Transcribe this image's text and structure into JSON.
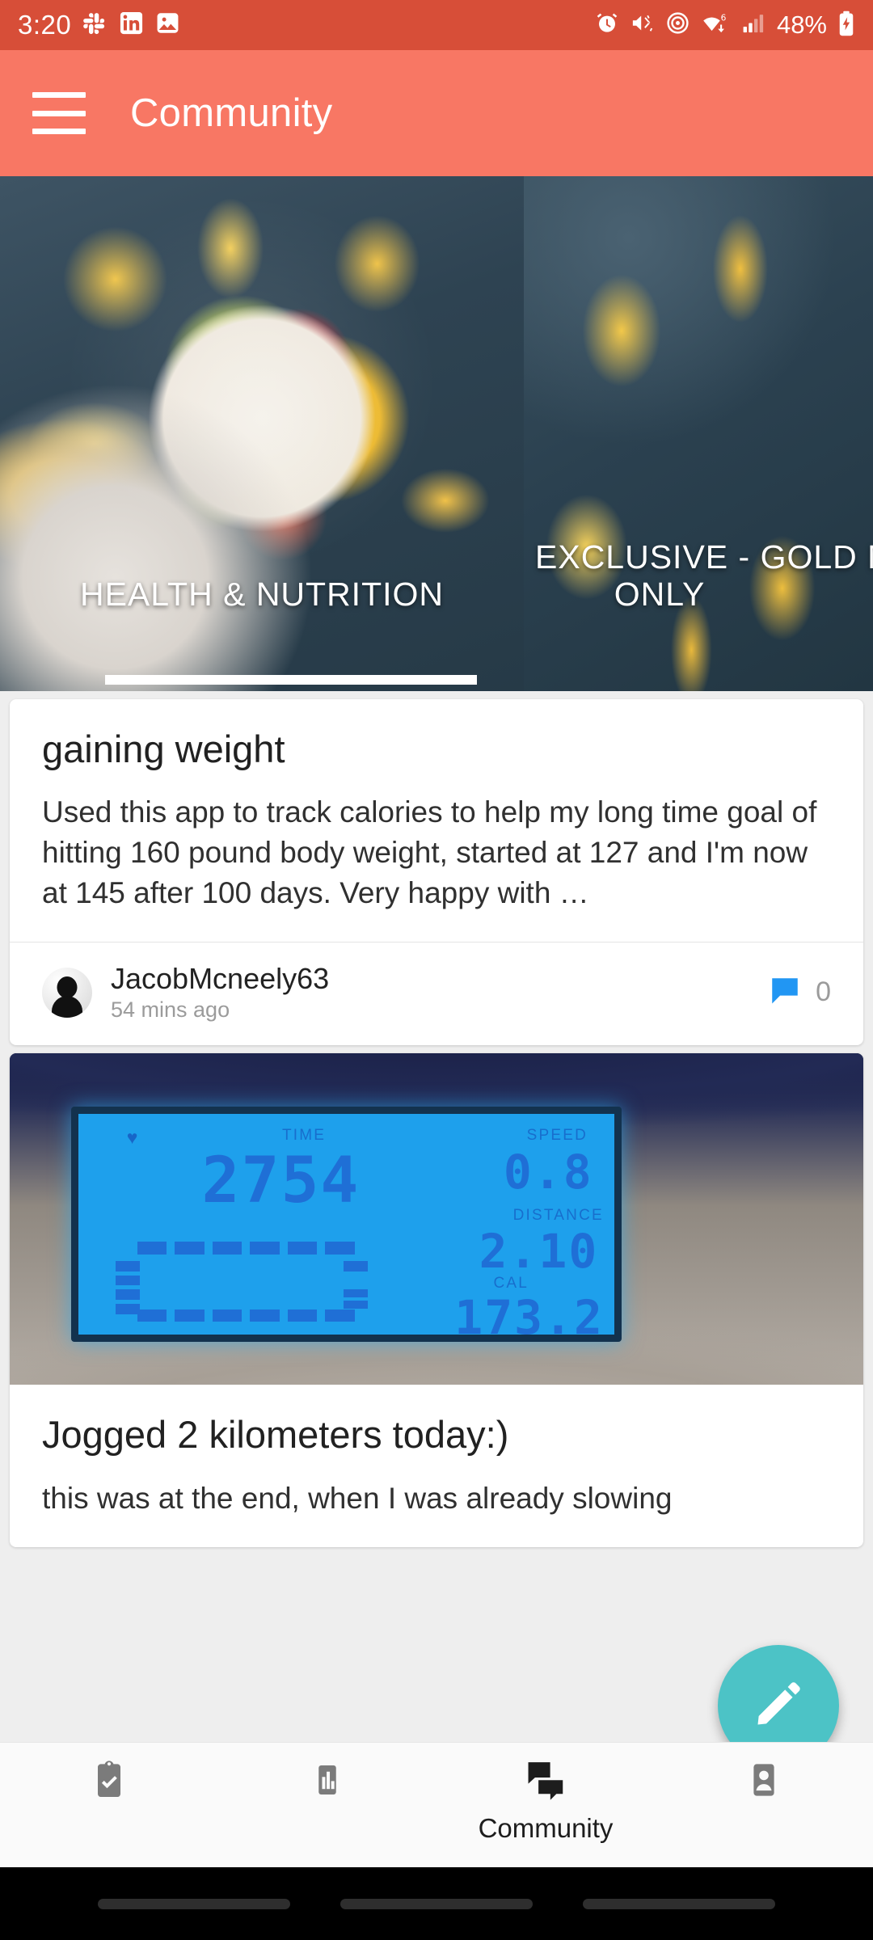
{
  "status_bar": {
    "time": "3:20",
    "battery": "48%",
    "left_icons": [
      "slack-icon",
      "linkedin-icon",
      "photos-icon"
    ],
    "right_icons": [
      "alarm-icon",
      "vibrate-icon",
      "hotspot-icon",
      "wifi-icon",
      "signal-icon",
      "battery-charging-icon"
    ],
    "wifi_generation": "6",
    "background_color": "#d74e38"
  },
  "app_bar": {
    "title": "Community",
    "menu_icon": "hamburger-menu-icon",
    "background_color": "#f87764"
  },
  "carousel": {
    "slides": [
      {
        "caption": "HEALTH & NUTRITION",
        "image": "fruit-platter-photo"
      },
      {
        "caption_line1": "EXCLUSIVE - GOLD ME",
        "caption_line2": "ONLY",
        "image": "gold-members-photo"
      }
    ],
    "indicator_color": "#ffffff"
  },
  "feed": {
    "posts": [
      {
        "title": "gaining weight",
        "text": "Used this app to track calories to help my long time goal of hitting 160 pound body weight, started at 127 and I'm now at 145 after 100 days. Very happy with …",
        "author": "JacobMcneely63",
        "time": "54 mins ago",
        "comment_count": "0",
        "comment_icon_color": "#2196f3",
        "avatar": "user-avatar"
      },
      {
        "title": "Jogged 2 kilometers today:)",
        "text": "this was at the end, when I was already slowing",
        "image": "treadmill-console-photo",
        "treadmill": {
          "heart_icon": "heart-icon",
          "time_label": "TIME",
          "time_value": "2754",
          "speed_label": "SPEED",
          "speed_value": "0.8",
          "distance_label": "DISTANCE",
          "distance_value": "2.10",
          "cal_label": "CAL",
          "cal_value": "173.2"
        }
      }
    ]
  },
  "fab": {
    "name": "compose-post-button",
    "icon": "pencil-icon",
    "color": "#4cc3c6"
  },
  "bottom_nav": {
    "items": [
      {
        "label": "",
        "icon": "clipboard-check-icon",
        "active": false
      },
      {
        "label": "",
        "icon": "bar-chart-icon",
        "active": false
      },
      {
        "label": "Community",
        "icon": "chat-community-icon",
        "active": true
      },
      {
        "label": "",
        "icon": "person-icon",
        "active": false
      }
    ]
  }
}
